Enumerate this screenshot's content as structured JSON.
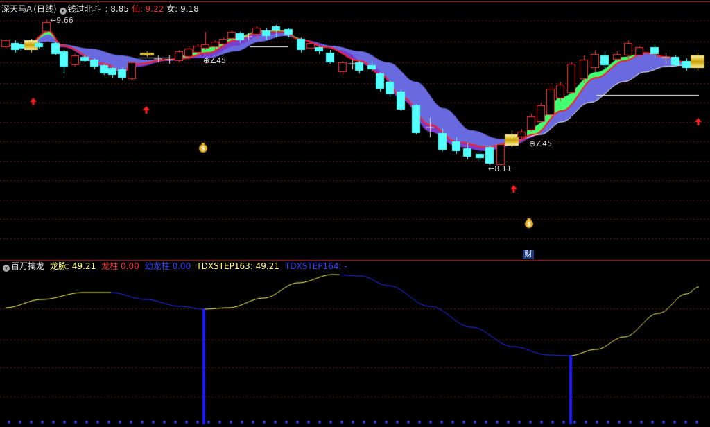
{
  "top_header": {
    "stock_name": "深天马A",
    "period": "(日线)",
    "indicator_name": "钱过北斗",
    "values": [
      {
        "label": " : ",
        "value": "8.85",
        "color": "#e0e0e0"
      },
      {
        "label": " 仙: ",
        "value": "9.22",
        "color": "#ff3030"
      },
      {
        "label": " 女: ",
        "value": "9.18",
        "color": "#e0e0e0"
      }
    ]
  },
  "bottom_header": {
    "indicator_name": "百万擒龙",
    "items": [
      {
        "label": "龙脉: ",
        "value": "49.21",
        "color": "#ffff66"
      },
      {
        "label": "龙柱 ",
        "value": "0.00",
        "color": "#ff3030"
      },
      {
        "label": "幼龙柱 ",
        "value": "0.00",
        "color": "#3040ff"
      },
      {
        "label": "TDXSTEP163: ",
        "value": "49.21",
        "color": "#ffff66"
      },
      {
        "label": "TDXSTEP164: ",
        "value": "-",
        "color": "#3040ff"
      }
    ]
  },
  "annotations": {
    "high_label": "9.66",
    "low_label": "8.11",
    "angle_label_1": "∠45",
    "angle_label_2": "∠45",
    "cai_label": "财",
    "money_icon": "money-bag-icon",
    "arrow_icon": "red-up-arrow-icon"
  },
  "colors": {
    "up_candle": "#ff3030",
    "down_candle": "#54ffff",
    "ribbon_green": "#40ff70",
    "ribbon_blue": "#6a6ae0",
    "ribbon_purple": "#7c3ccc",
    "line_yellow": "#ffff66",
    "line_blue": "#2030ff"
  }
}
